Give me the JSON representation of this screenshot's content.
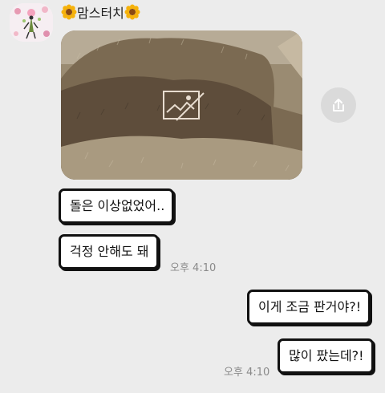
{
  "sender": {
    "name": "맘스터치",
    "avatar_icon": "flower-bouquet-avatar",
    "decoration_icon": "sunflower-icon"
  },
  "photo_message": {
    "placeholder_icon": "broken-image-icon",
    "colors": {
      "dry_grass": "#8a7a62",
      "dark_grass": "#5e4d3b",
      "light_grass": "#a99a80"
    }
  },
  "share": {
    "icon": "share-upload-icon"
  },
  "messages": [
    {
      "side": "left",
      "text": "돌은 이상없었어.."
    },
    {
      "side": "left",
      "text": "걱정 안해도 돼",
      "time": "오후 4:10"
    },
    {
      "side": "right",
      "text": "이게 조금 판거야?!"
    },
    {
      "side": "right",
      "text": "많이 팠는데?!",
      "time": "오후 4:10"
    }
  ]
}
